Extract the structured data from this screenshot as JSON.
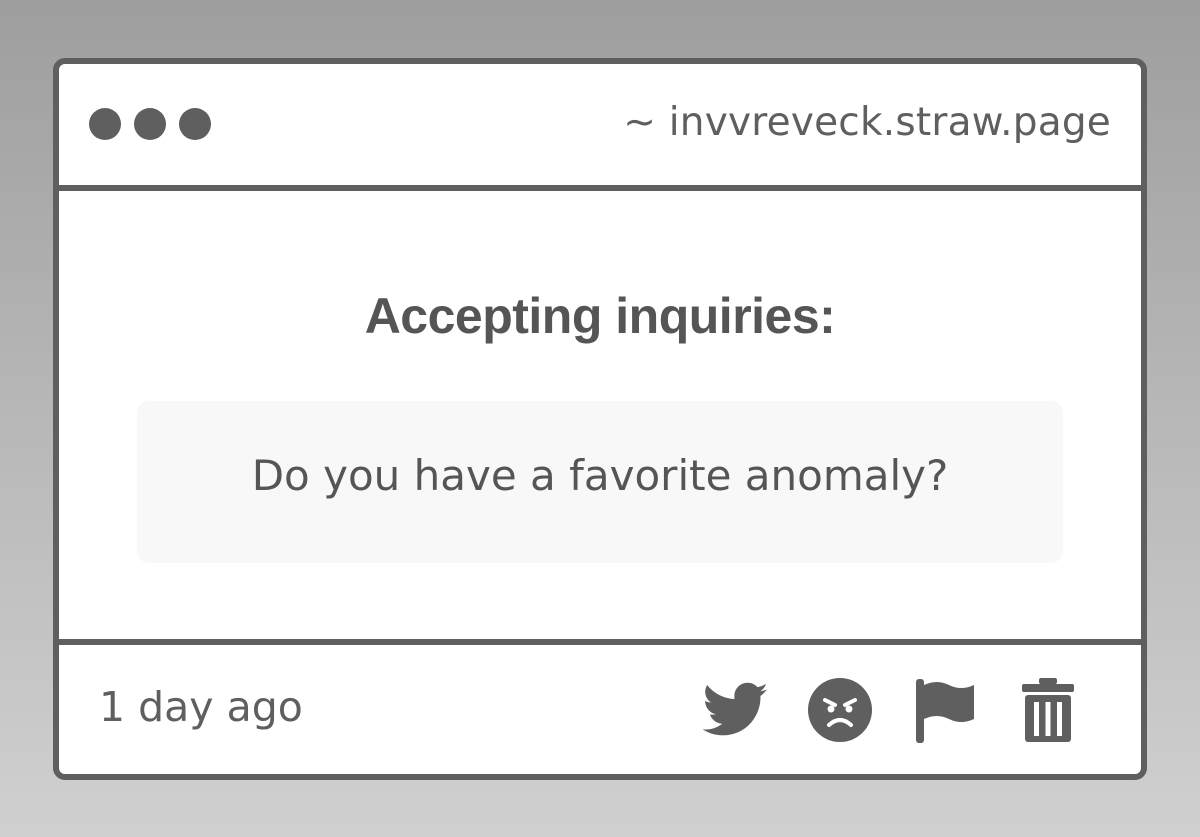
{
  "window": {
    "url": "~ invvreveck.straw.page"
  },
  "content": {
    "heading": "Accepting inquiries:",
    "question": "Do you have a favorite anomaly?"
  },
  "footer": {
    "timestamp": "1 day ago",
    "actions": [
      {
        "icon": "twitter-bird-icon"
      },
      {
        "icon": "angry-face-icon"
      },
      {
        "icon": "flag-icon"
      },
      {
        "icon": "trash-icon"
      }
    ]
  },
  "colors": {
    "frame": "#5f5f5f",
    "text": "#555555",
    "question_bg": "#f8f8f8"
  }
}
